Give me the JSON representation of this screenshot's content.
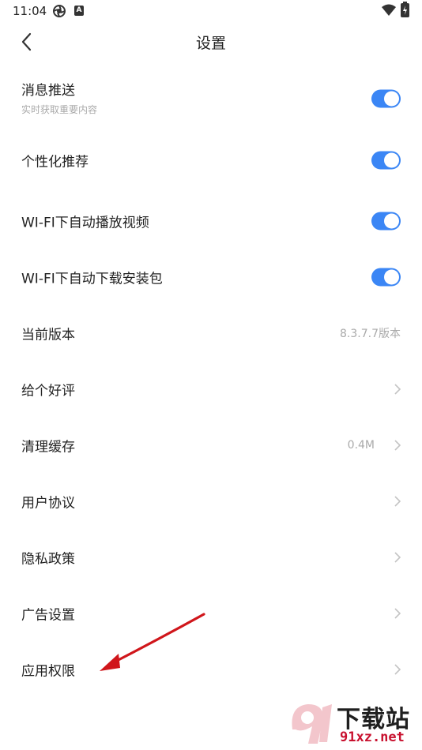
{
  "status_bar": {
    "time": "11:04",
    "icon_b_letter": "A",
    "icons": [
      "recording-icon",
      "a-letter-icon",
      "wifi-icon",
      "battery-charging-icon"
    ]
  },
  "header": {
    "title": "设置",
    "back_icon": "chevron-left-icon"
  },
  "settings": [
    {
      "label": "消息推送",
      "sub": "实时获取重要内容",
      "control": "toggle",
      "on": true
    },
    {
      "label": "个性化推荐",
      "control": "toggle",
      "on": true
    },
    {
      "label": "WI-FI下自动播放视频",
      "control": "toggle",
      "on": true
    },
    {
      "label": "WI-FI下自动下载安装包",
      "control": "toggle",
      "on": true
    },
    {
      "label": "当前版本",
      "control": "value",
      "value": "8.3.7.7版本"
    },
    {
      "label": "给个好评",
      "control": "chevron"
    },
    {
      "label": "清理缓存",
      "control": "value-chevron",
      "value": "0.4M"
    },
    {
      "label": "用户协议",
      "control": "chevron"
    },
    {
      "label": "隐私政策",
      "control": "chevron"
    },
    {
      "label": "广告设置",
      "control": "chevron"
    },
    {
      "label": "应用权限",
      "control": "chevron"
    }
  ],
  "colors": {
    "toggle_on": "#3b86f5",
    "annotation_arrow": "#d0161b",
    "watermark_red": "#c8102e"
  },
  "watermark": {
    "text": "下载站",
    "domain": "91xz.net"
  }
}
